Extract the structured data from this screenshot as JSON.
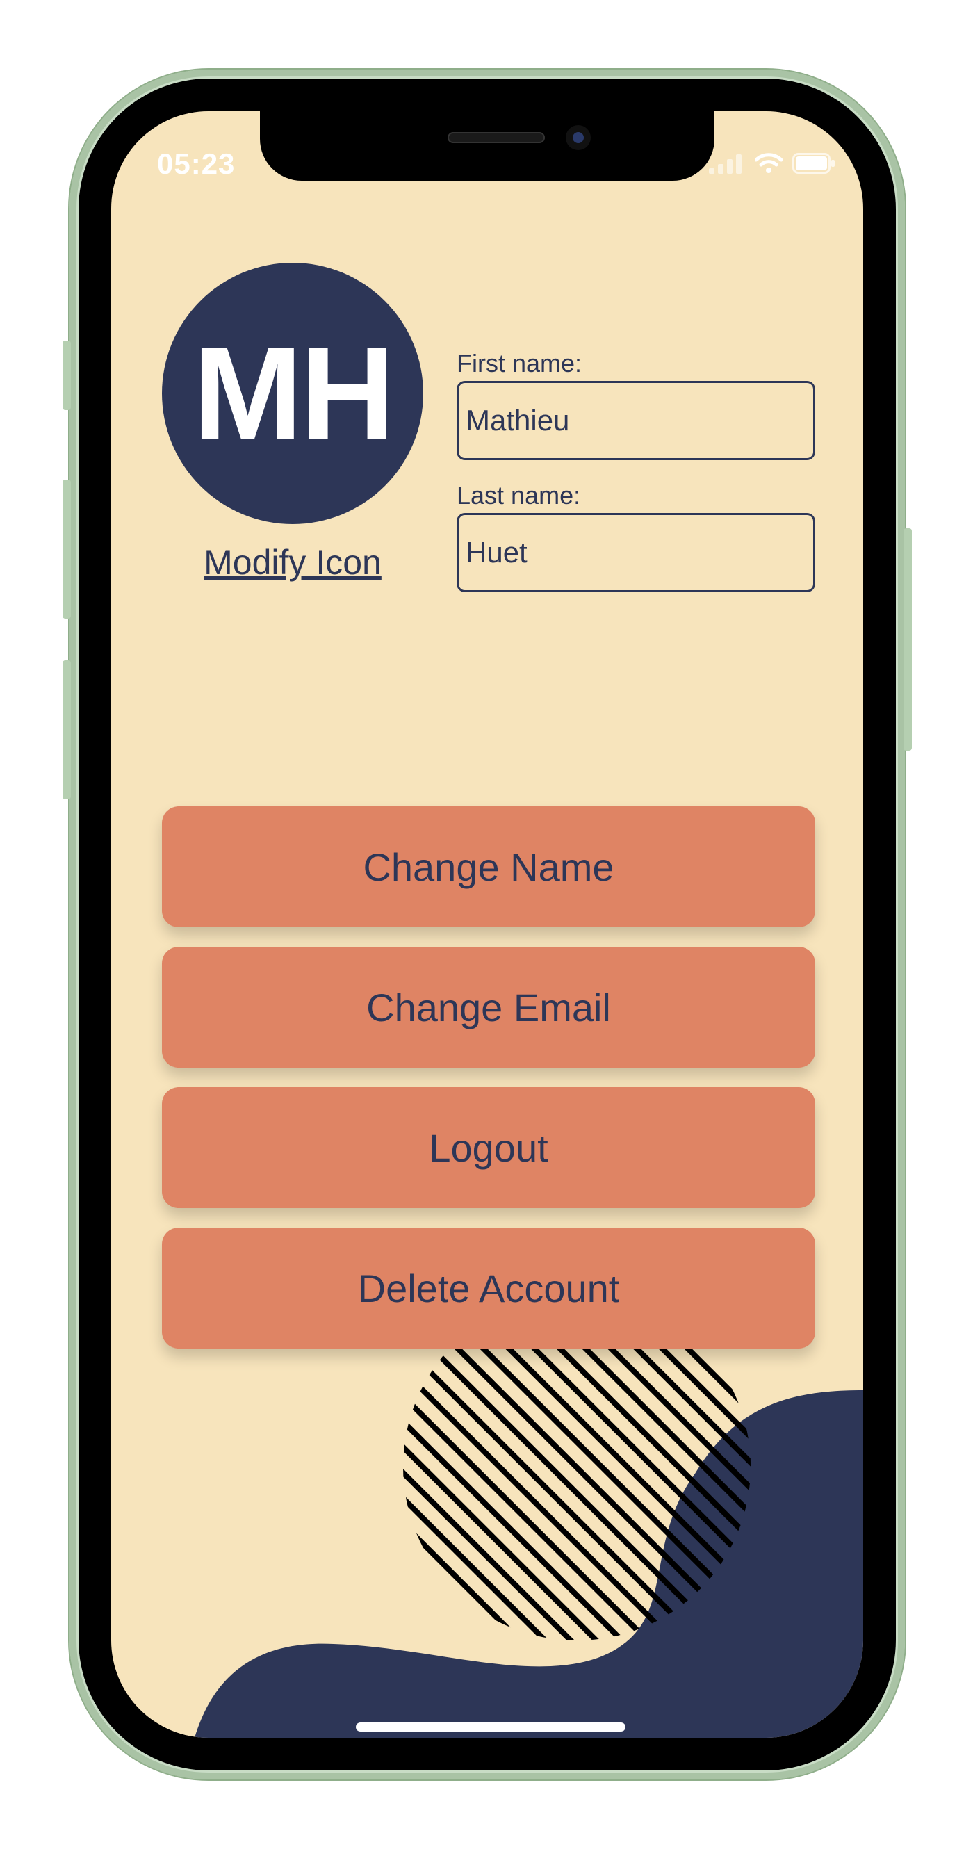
{
  "status_bar": {
    "time": "05:23",
    "icons": [
      "signal-icon",
      "wifi-icon",
      "battery-icon"
    ]
  },
  "profile": {
    "initials": "MH",
    "modify_icon_label": "Modify Icon"
  },
  "form": {
    "first_name_label": "First name:",
    "first_name_value": "Mathieu",
    "last_name_label": "Last name:",
    "last_name_value": "Huet"
  },
  "actions": {
    "change_name": "Change Name",
    "change_email": "Change Email",
    "logout": "Logout",
    "delete_account": "Delete Account"
  },
  "colors": {
    "background": "#f7e4bc",
    "primary_dark": "#2d3657",
    "button": "#df8464",
    "phone_frame": "#c8dcc5"
  }
}
